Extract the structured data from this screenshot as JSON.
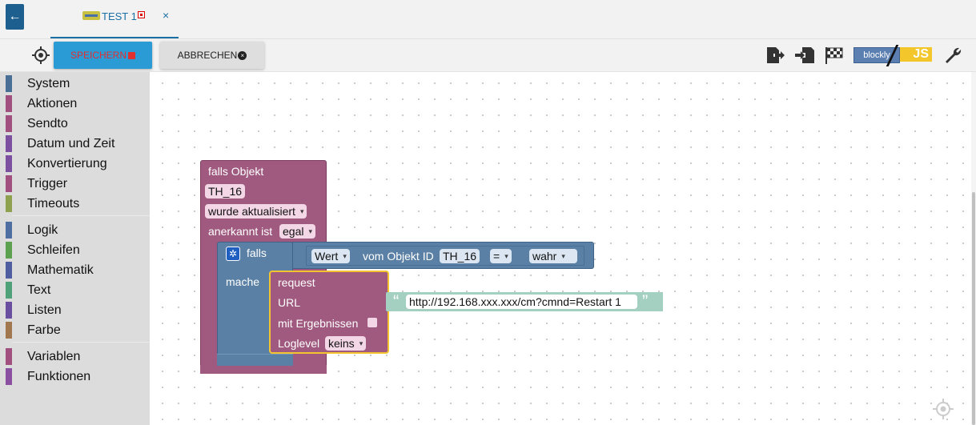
{
  "tab": {
    "title": "TEST 1",
    "close": "×",
    "back": "←"
  },
  "toolbar": {
    "save_label": "SPEICHERN",
    "save_icon": "💾",
    "cancel_label": "ABBRECHEN",
    "cancel_icon": "✖",
    "logo_blockly": "blockly",
    "logo_js": "JS",
    "icons": [
      "target-icon",
      "export-icon",
      "import-icon",
      "flag-icon",
      "wrench-icon"
    ]
  },
  "sidebar": {
    "items": [
      {
        "label": "System",
        "color": "#4a6f96"
      },
      {
        "label": "Aktionen",
        "color": "#a14f7e"
      },
      {
        "label": "Sendto",
        "color": "#a14f7e"
      },
      {
        "label": "Datum und Zeit",
        "color": "#7c4fa1"
      },
      {
        "label": "Konvertierung",
        "color": "#7c4fa1"
      },
      {
        "label": "Trigger",
        "color": "#a14f7e"
      },
      {
        "label": "Timeouts",
        "color": "#8ea14f"
      },
      {
        "label": "Logik",
        "color": "#4f6ea1"
      },
      {
        "label": "Schleifen",
        "color": "#5ba14f"
      },
      {
        "label": "Mathematik",
        "color": "#4f5ea1"
      },
      {
        "label": "Text",
        "color": "#4fa17a"
      },
      {
        "label": "Listen",
        "color": "#6a4fa1"
      },
      {
        "label": "Farbe",
        "color": "#a1774f"
      },
      {
        "label": "Variablen",
        "color": "#a14f7e"
      },
      {
        "label": "Funktionen",
        "color": "#8a4fa1"
      }
    ]
  },
  "blocks": {
    "trigger": {
      "title": "falls Objekt",
      "object": "TH_16",
      "event": "wurde aktualisiert",
      "ack_label": "anerkannt ist",
      "ack_value": "egal"
    },
    "if": {
      "label": "falls",
      "do_label": "mache",
      "value_dd": "Wert",
      "of_object": "vom Objekt ID",
      "object": "TH_16",
      "op": "=",
      "bool": "wahr"
    },
    "request": {
      "title": "request",
      "url_label": "URL",
      "url_value": "http://192.168.xxx.xxx/cm?cmnd=Restart 1",
      "results_label": "mit Ergebnissen",
      "loglevel_label": "Loglevel",
      "loglevel_value": "keins",
      "quote_open": "“",
      "quote_close": "”"
    }
  }
}
